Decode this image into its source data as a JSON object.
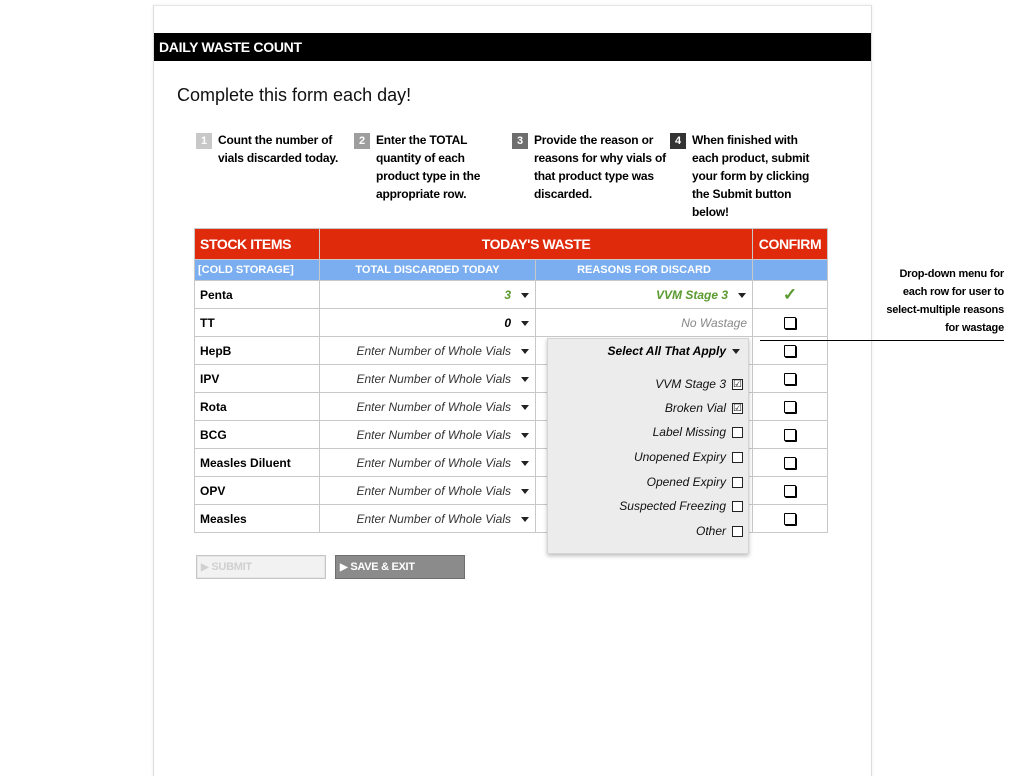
{
  "header": {
    "title": "DAILY WASTE COUNT"
  },
  "subtitle": "Complete this form each day!",
  "steps": [
    {
      "number": "1",
      "text": "Count the number of vials discarded today.",
      "color": "#c8c8c8"
    },
    {
      "number": "2",
      "text": "Enter the TOTAL quantity of each product type in the appropriate row.",
      "color": "#9e9e9e"
    },
    {
      "number": "3",
      "text": "Provide the reason or reasons for why vials of that product type was discarded.",
      "color": "#6e6e6e"
    },
    {
      "number": "4",
      "text": "When finished with each product,  submit your form by clicking the Submit button below!",
      "color": "#333333"
    }
  ],
  "table": {
    "headers": {
      "stock": "STOCK ITEMS",
      "waste": "TODAY'S WASTE",
      "confirm": "CONFIRM"
    },
    "subheaders": {
      "stock": "[COLD STORAGE]",
      "total": "TOTAL DISCARDED TODAY",
      "reasons": "REASONS FOR DISCARD"
    },
    "rows": [
      {
        "name": "Penta",
        "qty": "3",
        "reason": "VVM Stage 3",
        "confirm": "✓"
      },
      {
        "name": "TT",
        "qty": "0",
        "reason": "No Wastage",
        "confirm": ""
      },
      {
        "name": "HepB",
        "qty": "Enter Number of Whole Vials",
        "reason": "",
        "confirm": ""
      },
      {
        "name": "IPV",
        "qty": "Enter Number of Whole Vials",
        "reason": "",
        "confirm": ""
      },
      {
        "name": "Rota",
        "qty": "Enter Number of Whole Vials",
        "reason": "",
        "confirm": ""
      },
      {
        "name": "BCG",
        "qty": "Enter Number of Whole Vials",
        "reason": "",
        "confirm": ""
      },
      {
        "name": "Measles Diluent",
        "qty": "Enter Number of Whole Vials",
        "reason": "",
        "confirm": ""
      },
      {
        "name": "OPV",
        "qty": "Enter Number of Whole Vials",
        "reason": "",
        "confirm": ""
      },
      {
        "name": "Measles",
        "qty": "Enter Number of Whole Vials",
        "reason": "",
        "confirm": ""
      }
    ]
  },
  "dropdown": {
    "header": "Select All That Apply",
    "options": [
      {
        "label": "VVM Stage 3",
        "checked": "☑"
      },
      {
        "label": "Broken Vial",
        "checked": "☑"
      },
      {
        "label": "Label Missing",
        "checked": ""
      },
      {
        "label": "Unopened Expiry",
        "checked": ""
      },
      {
        "label": "Opened Expiry",
        "checked": ""
      },
      {
        "label": "Suspected Freezing",
        "checked": ""
      },
      {
        "label": "Other",
        "checked": ""
      }
    ]
  },
  "buttons": {
    "submit": "SUBMIT",
    "save_exit": "SAVE & EXIT"
  },
  "annotation": "Drop-down menu for each row for user to select-multiple reasons for wastage",
  "colors": {
    "header_red": "#e02a0c",
    "subheader_blue": "#7aaef0",
    "check_green": "#5a9a2e"
  }
}
